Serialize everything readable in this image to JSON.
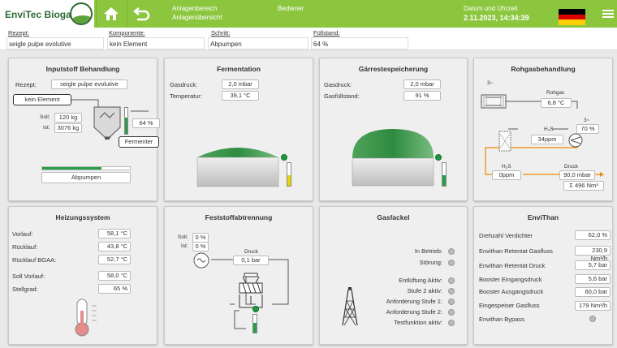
{
  "header": {
    "logo_text": "EnviTec Biogas",
    "area_label": "Anlagenbereich",
    "area_value": "Anlagenübersicht",
    "operator_label": "Bediener",
    "datetime_label": "Datum und Uhrzeit",
    "datetime_value": "2.11.2023, 14:34:39",
    "flag_colors": [
      "#000000",
      "#dd0000",
      "#ffce00"
    ]
  },
  "infobar": {
    "recipe_label": "Rezept:",
    "recipe_value": "seigle pulpe evolutive",
    "component_label": "Komponente:",
    "component_value": "kein Element",
    "step_label": "Schritt:",
    "step_value": "Abpumpen",
    "fill_label": "Füllstand:",
    "fill_value": "64 %"
  },
  "inputstoff": {
    "title": "Inputstoff Behandlung",
    "recipe_label": "Rezept:",
    "recipe_value": "seigle pulpe evolutive",
    "element_button": "kein Element",
    "soll_label": "Soll:",
    "soll_value": "120 kg",
    "ist_label": "Ist:",
    "ist_value": "3076 kg",
    "fill_value": "64 %",
    "fill_fraction": 0.64,
    "fermenter_button": "Fermenter",
    "progress_fraction": 0.68,
    "pump_button": "Abpumpen"
  },
  "fermentation": {
    "title": "Fermentation",
    "gas_pressure_label": "Gasdruck:",
    "gas_pressure_value": "2,0 mbar",
    "temperature_label": "Temperatur:",
    "temperature_value": "39,1 °C",
    "level_fraction": 0.45
  },
  "gaerrest": {
    "title": "Gärrestespeicherung",
    "gas_pressure_label": "Gasdruck:",
    "gas_pressure_value": "2,0 mbar",
    "gas_fill_label": "Gasfüllstand:",
    "gas_fill_value": "91 %",
    "level_fraction": 0.45
  },
  "rohgas": {
    "title": "Rohgasbehandlung",
    "heat_exchanger_label": "3~",
    "rohgas_label": "Rohgas",
    "rohgas_temp": "6,8 °C",
    "fan_label": "3~",
    "fan_percent": "70 %",
    "h2s_label_1": "H₂S",
    "h2s_value_1": "34ppm",
    "h2s_label_2": "H₂S",
    "h2s_value_2": "0ppm",
    "druck_label": "Druck",
    "druck_value": "90,0 mbar",
    "total_value": "Σ 496 Nm³"
  },
  "heizung": {
    "title": "Heizungssystem",
    "rows": [
      {
        "label": "Vorlauf:",
        "value": "58,1 °C"
      },
      {
        "label": "Rücklauf:",
        "value": "43,8 °C"
      },
      {
        "label": "Rücklauf BGAA:",
        "value": "52,7 °C"
      }
    ],
    "soll_vorlauf_label": "Soll Vorlauf:",
    "soll_vorlauf_value": "58,0 °C",
    "stellgrad_label": "Stellgrad:",
    "stellgrad_value": "65 %"
  },
  "feststoff": {
    "title": "Feststoffabtrennung",
    "soll_label": "Soll:",
    "soll_value": "0 %",
    "ist_label": "Ist:",
    "ist_value": "0 %",
    "druck_label": "Druck",
    "druck_value": "0,1 bar",
    "level_fraction": 0.55
  },
  "gasfackel": {
    "title": "Gasfackel",
    "statuses": [
      "In Betrieb:",
      "Störung:",
      "Entlüftung Aktiv:",
      "Stufe 2 aktiv:",
      "Anforderung Stufe 1:",
      "Anforderung Stufe 2:",
      "Testfunktion aktiv:"
    ]
  },
  "envithan": {
    "title": "EnviThan",
    "rows": [
      {
        "label": "Drehzahl Verdichter",
        "value": "62,0 %"
      },
      {
        "label": "Envithan Retentat Gasfluss",
        "value": "230,9 Nm³/h"
      },
      {
        "label": "Envithan Retentat Druck",
        "value": "5,7 bar"
      },
      {
        "label": "Booster Eingangsdruck",
        "value": "5,6 bar"
      },
      {
        "label": "Booster Ausgangsdruck",
        "value": "60,0 bar"
      },
      {
        "label": "Eingespeiser Gasfluss",
        "value": "179 Nm³/h"
      }
    ],
    "bypass_label": "Envithan Bypass"
  }
}
